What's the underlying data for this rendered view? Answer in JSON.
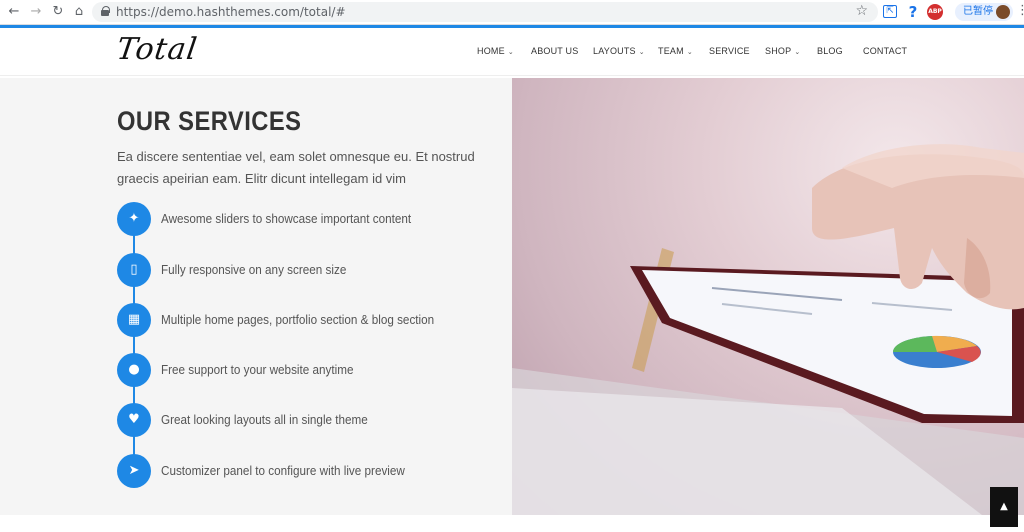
{
  "browser": {
    "url": "https://demo.hashthemes.com/total/#",
    "back_icon": "←",
    "forward_icon": "→",
    "reload_icon": "↻",
    "home_icon": "⌂",
    "star_icon": "☆",
    "help_icon": "?",
    "abp_label": "ABP",
    "paused_label": "已暂停",
    "menu_icon": "⋮"
  },
  "site": {
    "logo": "Total",
    "nav": [
      {
        "label": "HOME",
        "dropdown": true
      },
      {
        "label": "ABOUT US",
        "dropdown": false
      },
      {
        "label": "LAYOUTS",
        "dropdown": true
      },
      {
        "label": "TEAM",
        "dropdown": true
      },
      {
        "label": "SERVICE",
        "dropdown": false
      },
      {
        "label": "SHOP",
        "dropdown": true
      },
      {
        "label": "BLOG",
        "dropdown": false
      },
      {
        "label": "CONTACT",
        "dropdown": false
      }
    ]
  },
  "services": {
    "title": "OUR SERVICES",
    "description": "Ea discere sententiae vel, eam solet omnesque eu. Et nostrud graecis apeirian eam. Elitr dicunt intellegam id vim",
    "items": [
      {
        "icon": "rocket-icon",
        "glyph": "✦",
        "label": "Awesome sliders to showcase important content"
      },
      {
        "icon": "tablet-icon",
        "glyph": "▯",
        "label": "Fully responsive on any screen size"
      },
      {
        "icon": "grid-icon",
        "glyph": "▦",
        "label": "Multiple home pages, portfolio section & blog section"
      },
      {
        "icon": "user-icon",
        "glyph": "●",
        "label": "Free support to your website anytime"
      },
      {
        "icon": "heart-icon",
        "glyph": "♥",
        "label": "Great looking layouts all in single theme"
      },
      {
        "icon": "send-icon",
        "glyph": "➤",
        "label": "Customizer panel to configure with live preview"
      }
    ]
  },
  "colors": {
    "accent": "#1e88e5",
    "panel_bg": "#f5f5f5"
  },
  "back_to_top_icon": "▲"
}
